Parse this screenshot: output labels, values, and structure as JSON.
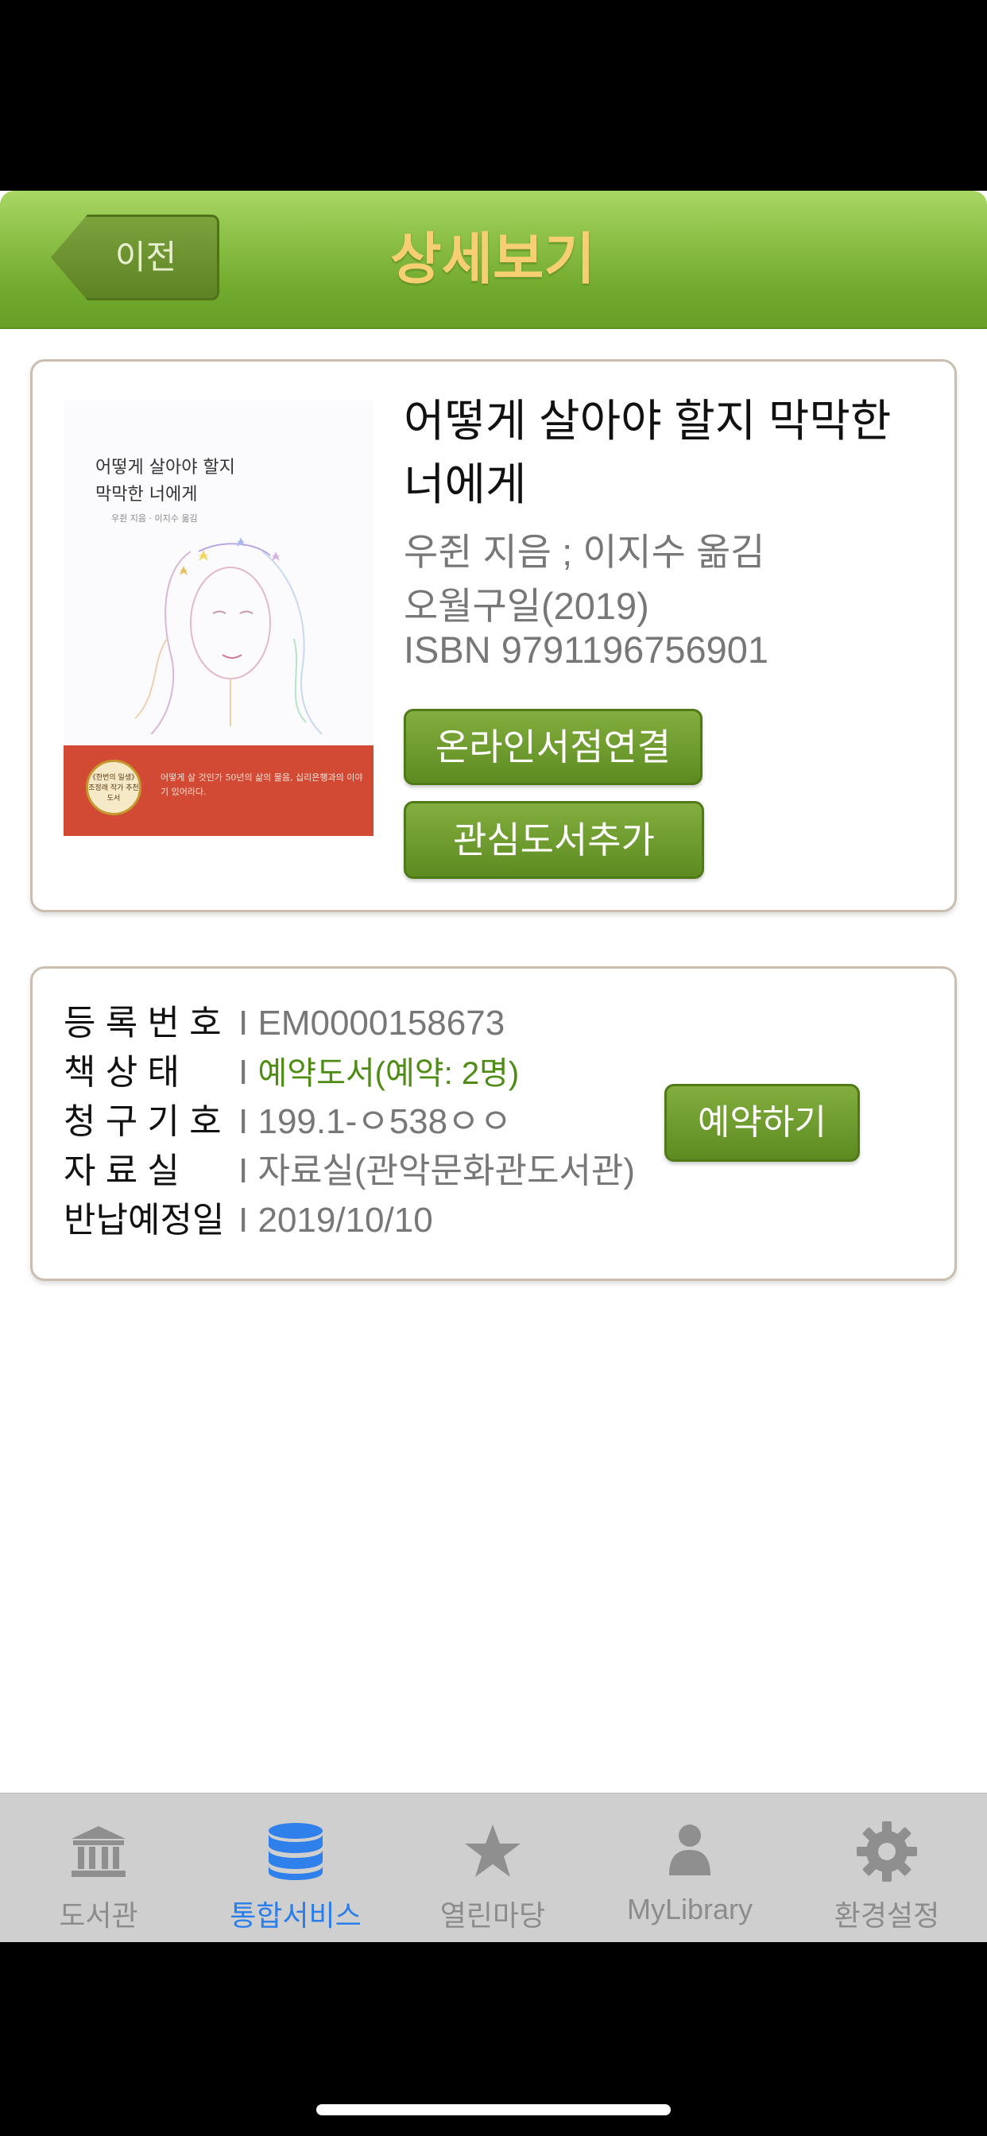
{
  "header": {
    "back_label": "이전",
    "title": "상세보기"
  },
  "book": {
    "title": "어떻게 살아야 할지 막막한 너에게",
    "author": "우쥔 지음 ; 이지수 옮김",
    "publisher": "오월구일(2019)",
    "isbn": "ISBN 9791196756901",
    "cover": {
      "title_line1": "어떻게 살아야 할지",
      "title_line2": "막막한 너에게",
      "subtitle": "우쥔 지음 · 이지수 옮김",
      "badge": "《한번의 일생》 조정래 작가 추천도서",
      "band_text": "어떻게 살 것인가 50년의 삶의 물음, 십리은행과의 이야기 있어라다.",
      "band_color": "#d24a33"
    },
    "buttons": {
      "online_store": "온라인서점연결",
      "add_interest": "관심도서추가"
    }
  },
  "holding": {
    "rows": [
      {
        "label": "등 록 번 호",
        "value": "EM0000158673"
      },
      {
        "label": "책    상    태",
        "value": "예약도서(예약: 2명)"
      },
      {
        "label": "청 구 기 호",
        "value": "199.1-ㅇ538ㅇㅇ"
      },
      {
        "label": "자    료    실",
        "value": "자료실(관악문화관도서관)"
      },
      {
        "label": "반납예정일",
        "value": "2019/10/10"
      }
    ],
    "separator": "I",
    "reserve_button": "예약하기",
    "status_color": "#4f8c14"
  },
  "tabs": [
    {
      "label": "도서관",
      "icon": "library-icon",
      "active": false
    },
    {
      "label": "통합서비스",
      "icon": "database-icon",
      "active": true
    },
    {
      "label": "열린마당",
      "icon": "star-icon",
      "active": false
    },
    {
      "label": "MyLibrary",
      "icon": "person-icon",
      "active": false
    },
    {
      "label": "환경설정",
      "icon": "gear-icon",
      "active": false
    }
  ],
  "colors": {
    "header_green": "#8cc046",
    "title_gold": "#f6cf72",
    "button_green": "#6f9c2f",
    "tab_active": "#2b7de9",
    "tab_inactive": "#8c8c8c"
  }
}
